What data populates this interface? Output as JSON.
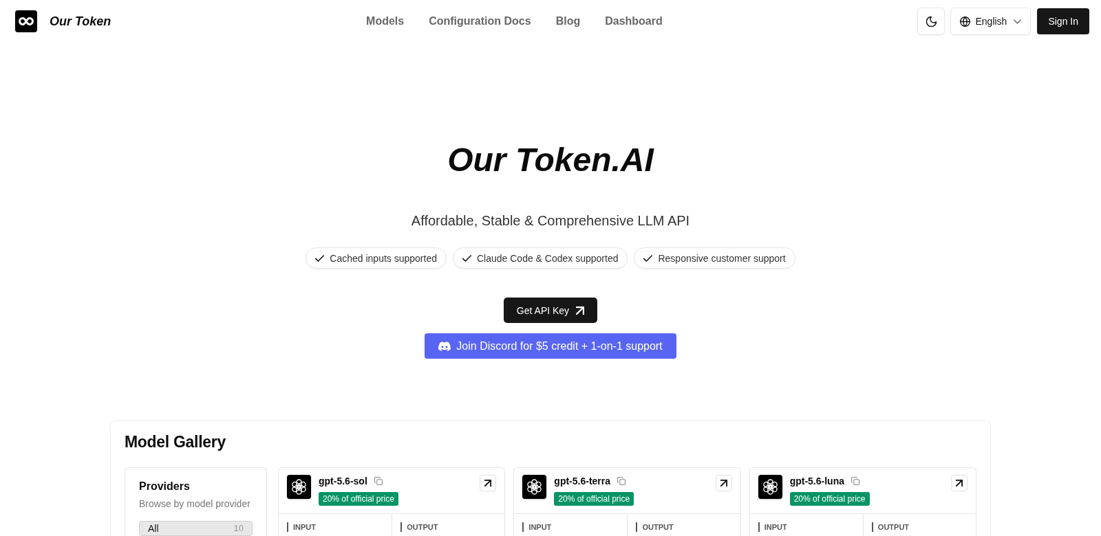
{
  "header": {
    "brand": "Our Token",
    "nav": [
      "Models",
      "Configuration Docs",
      "Blog",
      "Dashboard"
    ],
    "language": "English",
    "sign_in": "Sign In"
  },
  "hero": {
    "title": "Our Token.AI",
    "subtitle": "Affordable, Stable & Comprehensive LLM API",
    "features": [
      "Cached inputs supported",
      "Claude Code & Codex supported",
      "Responsive customer support"
    ],
    "api_key_button": "Get API Key",
    "discord_button": "Join Discord for $5 credit + 1-on-1 support"
  },
  "gallery": {
    "title": "Model Gallery",
    "providers": {
      "title": "Providers",
      "subtitle": "Browse by model provider",
      "items": [
        {
          "label": "All",
          "count": "10",
          "selected": true
        }
      ]
    },
    "models": [
      {
        "name": "gpt-5.6-sol",
        "badge": "20% of official price",
        "price_columns": [
          "INPUT",
          "OUTPUT"
        ]
      },
      {
        "name": "gpt-5.6-terra",
        "badge": "20% of official price",
        "price_columns": [
          "INPUT",
          "OUTPUT"
        ]
      },
      {
        "name": "gpt-5.6-luna",
        "badge": "20% of official price",
        "price_columns": [
          "INPUT",
          "OUTPUT"
        ]
      }
    ]
  }
}
